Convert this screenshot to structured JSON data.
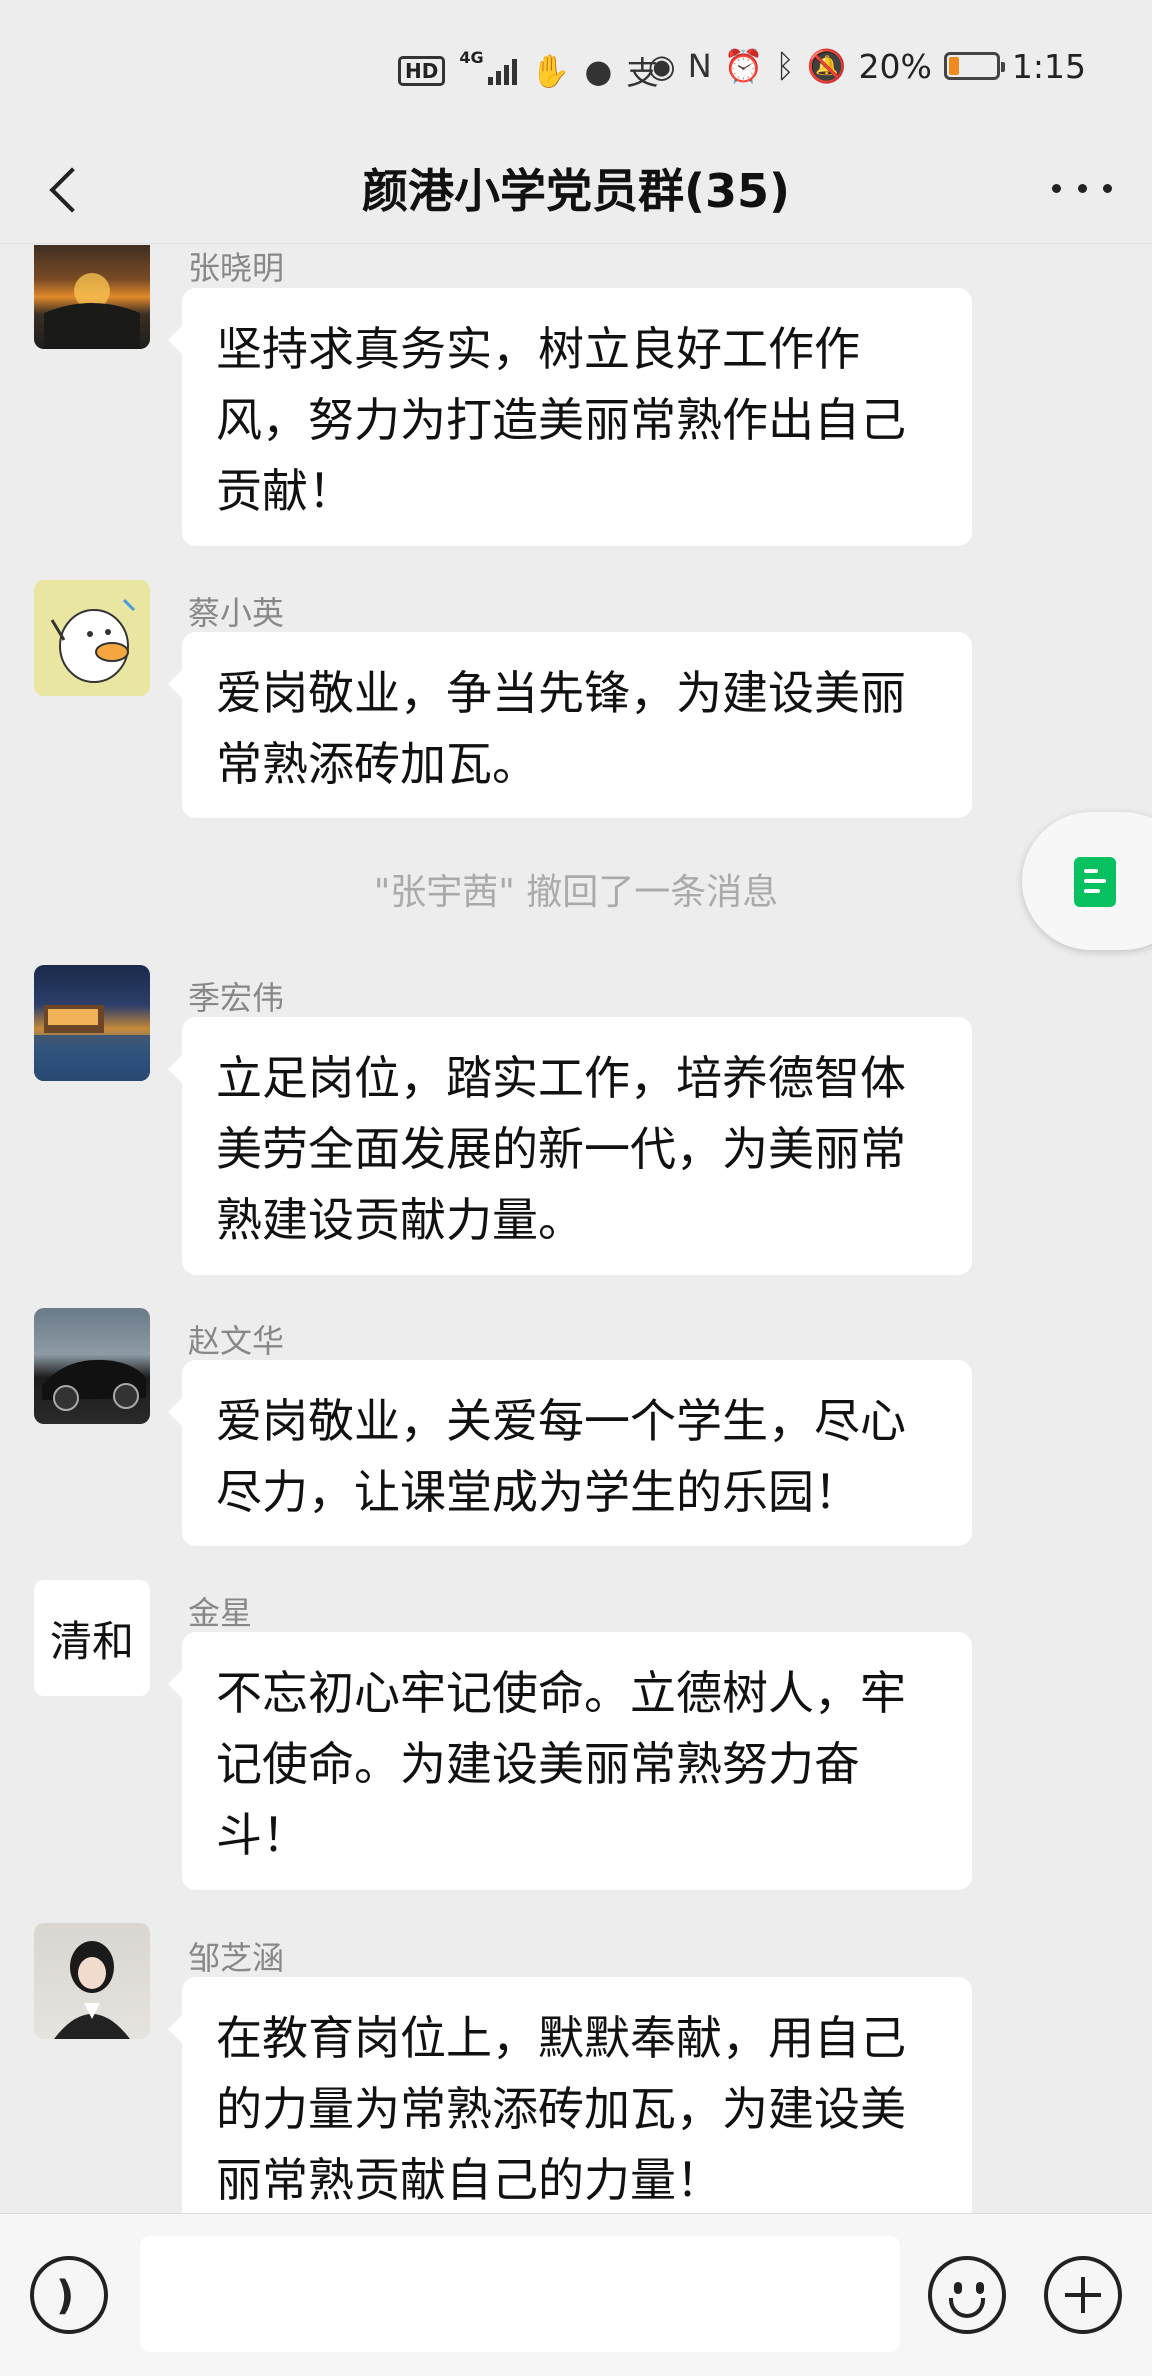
{
  "status_bar": {
    "hd": "HD",
    "network": "4G",
    "battery_percent": "20%",
    "battery_level": 0.2,
    "time": "1:15",
    "icons": [
      "hd-icon",
      "signal-icon",
      "hand-icon",
      "chat-bubble-icon",
      "alipay-icon",
      "eye-icon",
      "nfc-icon",
      "alarm-icon",
      "bluetooth-icon",
      "mute-icon",
      "battery-icon"
    ]
  },
  "header": {
    "title": "颜港小学党员群(35)"
  },
  "messages": [
    {
      "sender": "张晓明",
      "text": "坚持求真务实，树立良好工作作风，努力为打造美丽常熟作出自己贡献！"
    },
    {
      "sender": "蔡小英",
      "text": "爱岗敬业，争当先锋，为建设美丽常熟添砖加瓦。"
    },
    {
      "system": "\"张宇茜\" 撤回了一条消息"
    },
    {
      "sender": "季宏伟",
      "text": "立足岗位，踏实工作，培养德智体美劳全面发展的新一代，为美丽常熟建设贡献力量。"
    },
    {
      "sender": "赵文华",
      "text": "爱岗敬业，关爱每一个学生，尽心尽力，让课堂成为学生的乐园！"
    },
    {
      "sender": "金星",
      "text": "不忘初心牢记使命。立德树人，牢记使命。为建设美丽常熟努力奋斗！"
    },
    {
      "sender": "邹芝涵",
      "text": "在教育岗位上，默默奉献，用自己的力量为常熟添砖加瓦，为建设美丽常熟贡献自己的力量！"
    }
  ],
  "avatars": {
    "jinxing_text": "清和"
  },
  "colors": {
    "background": "#ededed",
    "bubble": "#ffffff",
    "accent": "#07c160",
    "battery": "#f08a1f"
  }
}
